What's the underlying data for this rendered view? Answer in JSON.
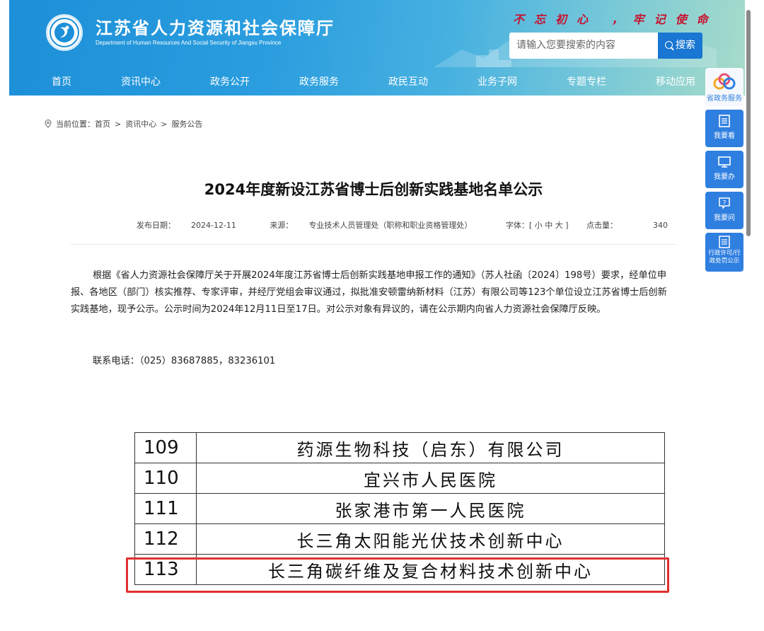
{
  "header": {
    "site_title": "江苏省人力资源和社会保障厅",
    "site_subtitle": "Department of Human Resources And Social Security of Jiangsu Province",
    "slogan": "不忘初心 ，牢记使命",
    "search": {
      "placeholder": "请输入您要搜索的内容",
      "button_label": "搜索"
    },
    "nav": [
      "首页",
      "资讯中心",
      "政务公开",
      "政务服务",
      "政民互动",
      "业务子网",
      "专题专栏",
      "移动应用"
    ]
  },
  "side_panel": {
    "items": [
      {
        "label": "省政务服务",
        "icon": "government-service-icon"
      },
      {
        "label": "我要看",
        "icon": "document-icon"
      },
      {
        "label": "我要办",
        "icon": "monitor-icon"
      },
      {
        "label": "我要问",
        "icon": "question-icon"
      },
      {
        "label": "行政许可/行政处罚公示",
        "icon": "list-icon"
      }
    ]
  },
  "breadcrumb": {
    "prefix": "当前位置：",
    "items": [
      "首页",
      "资讯中心",
      "服务公告"
    ],
    "separator": ">"
  },
  "article": {
    "title": "2024年度新设江苏省博士后创新实践基地名单公示",
    "meta": {
      "date_label": "发布日期：",
      "date": "2024-12-11",
      "source_label": "来源：",
      "source": "专业技术人员管理处（职称和职业资格管理处）",
      "font_label": "字体：[ 小 中 大 ]",
      "views_label": "点击量：",
      "views": "340"
    },
    "paragraph": "根据《省人力资源社会保障厅关于开展2024年度江苏省博士后创新实践基地申报工作的通知》（苏人社函〔2024〕198号）要求，经单位申报、各地区（部门）核实推荐、专家评审，并经厅党组会审议通过，拟批准安顿雷纳新材料（江苏）有限公司等123个单位设立江苏省博士后创新实践基地，现予公示。公示时间为2024年12月11日至17日。对公示对象有异议的，请在公示期内向省人力资源社会保障厅反映。",
    "contact": "联系电话：（025）83687885，83236101"
  },
  "table": {
    "rows": [
      {
        "num": "109",
        "name": "药源生物科技（启东）有限公司"
      },
      {
        "num": "110",
        "name": "宜兴市人民医院"
      },
      {
        "num": "111",
        "name": "张家港市第一人民医院"
      },
      {
        "num": "112",
        "name": "长三角太阳能光伏技术创新中心"
      },
      {
        "num": "113",
        "name": "长三角碳纤维及复合材料技术创新中心"
      }
    ],
    "highlight_color": "#e03030"
  },
  "colors": {
    "banner": "#2a9ddf",
    "accent": "#1976d2",
    "side_panel": "#2f7fe0"
  }
}
